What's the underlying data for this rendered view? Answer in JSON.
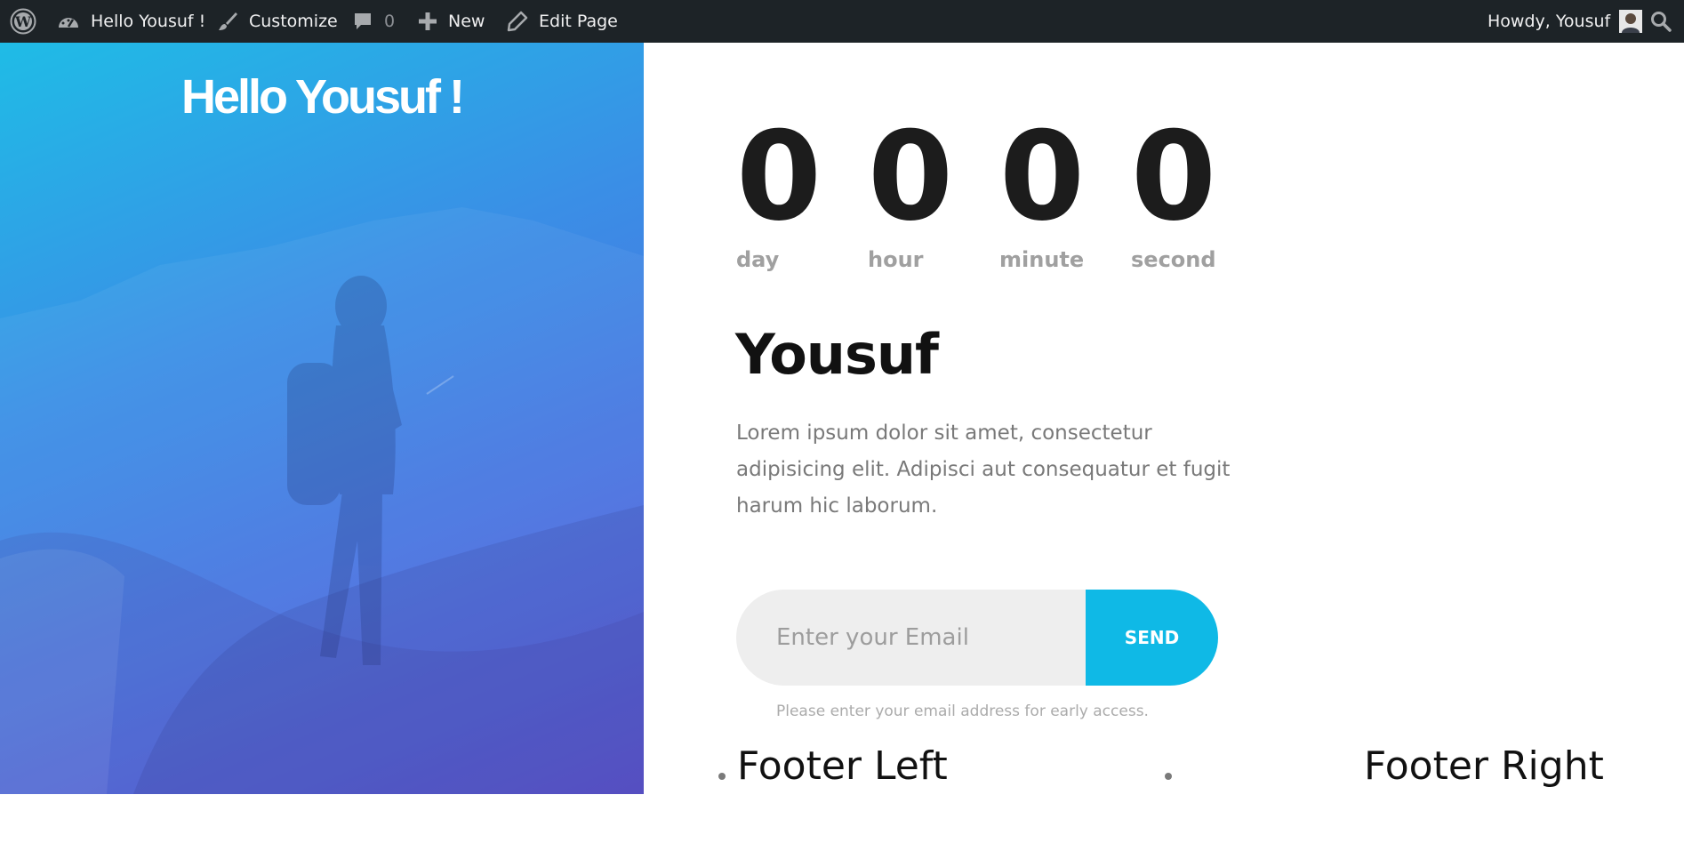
{
  "admin_bar": {
    "site_name": "Hello Yousuf !",
    "customize": "Customize",
    "comments_count": "0",
    "new": "New",
    "edit_page": "Edit Page",
    "greeting": "Howdy, Yousuf",
    "icons": [
      "wordpress-logo-icon",
      "dashboard-icon",
      "brush-icon",
      "comment-icon",
      "plus-icon",
      "pencil-icon",
      "avatar",
      "search-icon"
    ]
  },
  "hero": {
    "title": "Hello Yousuf !",
    "gradient_colors": [
      "#1fbce6",
      "#3a8fe6",
      "#5a54da"
    ]
  },
  "countdown": {
    "units": [
      {
        "value": "0",
        "label": "day"
      },
      {
        "value": "0",
        "label": "hour"
      },
      {
        "value": "0",
        "label": "minute"
      },
      {
        "value": "0",
        "label": "second"
      }
    ]
  },
  "content": {
    "heading": "Yousuf",
    "body": "Lorem ipsum dolor sit amet, consectetur adipisicing elit. Adipisci aut consequatur et fugit harum hic laborum."
  },
  "form": {
    "email_placeholder": "Enter your Email",
    "email_value": "",
    "send_label": "SEND",
    "hint": "Please enter your email address for early access.",
    "accent_color": "#0fb9e6"
  },
  "footer": {
    "left": "Footer Left",
    "right": "Footer Right"
  }
}
